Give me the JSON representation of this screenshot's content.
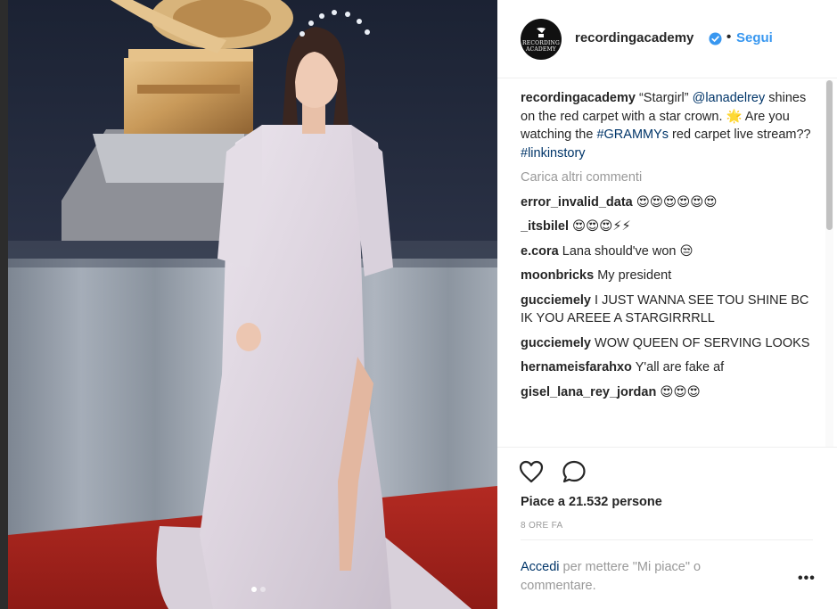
{
  "header": {
    "username": "recordingacademy",
    "separator": "•",
    "follow_label": "Segui",
    "avatar_text_line1": "RECORDING",
    "avatar_text_line2": "ACADEMY"
  },
  "caption": {
    "username": "recordingacademy",
    "text_part1": " “Stargirl” ",
    "mention": "@lanadelrey",
    "text_part2": " shines on the red carpet with a star crown. ",
    "star_emoji": "🌟",
    "text_part3": " Are you watching the ",
    "hashtag1": "#GRAMMYs",
    "text_part4": " red carpet live stream?? ",
    "hashtag2": "#linkinstory"
  },
  "load_more_label": "Carica altri commenti",
  "comments": [
    {
      "username": "error_invalid_data",
      "text": "😍😍😍😍😍😍"
    },
    {
      "username": "_itsbilel",
      "text": "😍😍😍⚡⚡"
    },
    {
      "username": "e.cora",
      "text": "Lana should've won 😒"
    },
    {
      "username": "moonbricks",
      "text": "My president"
    },
    {
      "username": "gucciemely",
      "text": "I JUST WANNA SEE TOU SHINE BC IK YOU AREEE A STARGIRRRLL"
    },
    {
      "username": "gucciemely",
      "text": "WOW QUEEN OF SERVING LOOKS"
    },
    {
      "username": "hernameisfarahxo",
      "text": "Y'all are fake af"
    },
    {
      "username": "gisel_lana_rey_jordan",
      "text": "😍😍😍"
    }
  ],
  "likes_text": "Piace a 21.532 persone",
  "timestamp": "8 ORE FA",
  "login": {
    "link": "Accedi",
    "rest": " per mettere \"Mi piace\" o commentare."
  },
  "more_options": "•••",
  "carousel": {
    "total": 2,
    "current": 1
  },
  "colors": {
    "link": "#003569",
    "follow": "#3897f0",
    "muted": "#999999",
    "verified": "#3897f0"
  }
}
